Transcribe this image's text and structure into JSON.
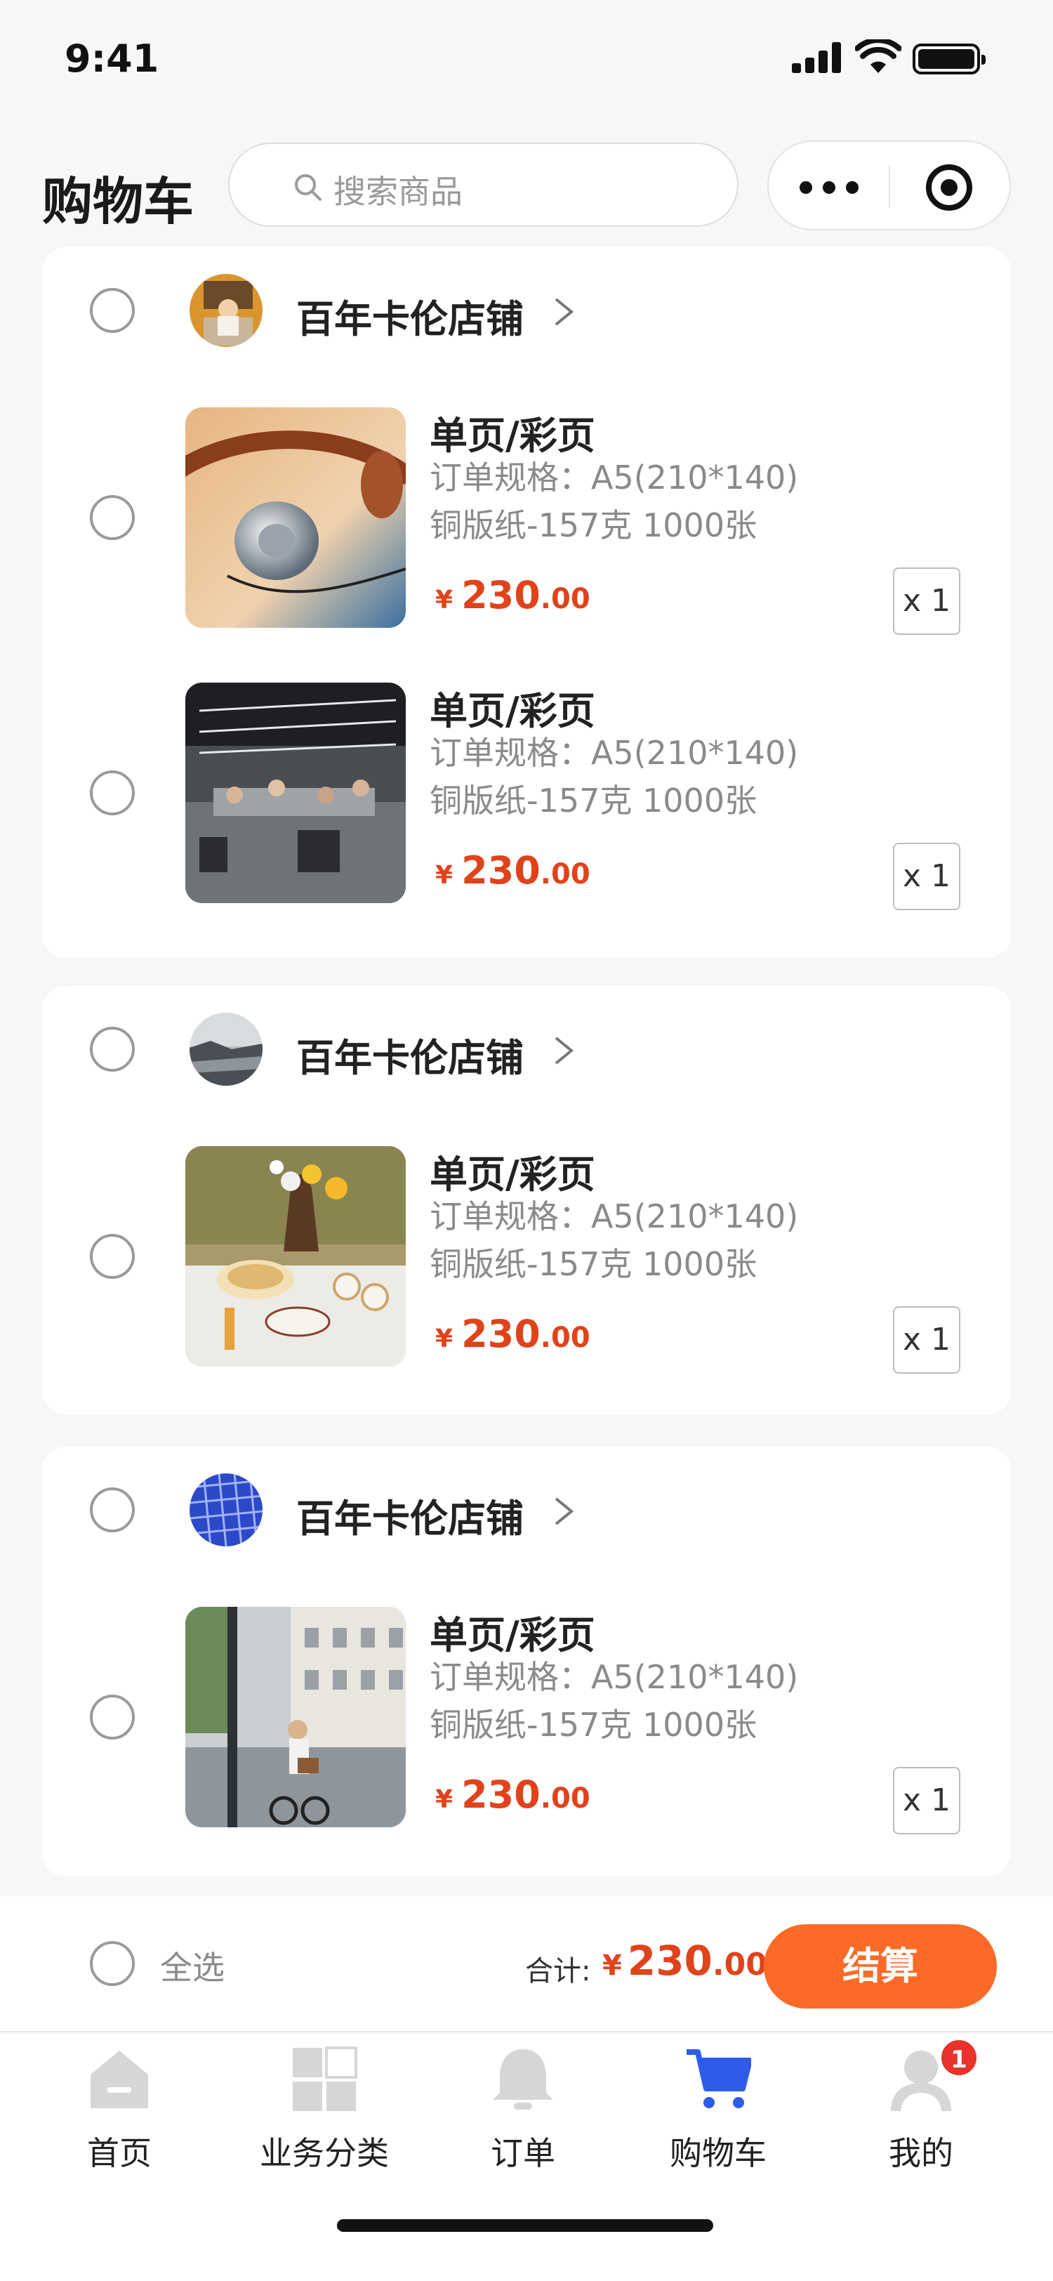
{
  "status_bar": {
    "time": "9:41"
  },
  "header": {
    "title": "购物车",
    "search_placeholder": "搜索商品"
  },
  "shops": [
    {
      "name": "百年卡伦店铺",
      "items": [
        {
          "title": "单页/彩页",
          "spec": "订单规格：A5(210*140)",
          "paper": "铜版纸-157克  1000张",
          "currency": "¥",
          "price_int": "230",
          "price_dec": ".00",
          "qty": "x 1"
        },
        {
          "title": "单页/彩页",
          "spec": "订单规格：A5(210*140)",
          "paper": "铜版纸-157克  1000张",
          "currency": "¥",
          "price_int": "230",
          "price_dec": ".00",
          "qty": "x 1"
        }
      ]
    },
    {
      "name": "百年卡伦店铺",
      "items": [
        {
          "title": "单页/彩页",
          "spec": "订单规格：A5(210*140)",
          "paper": "铜版纸-157克  1000张",
          "currency": "¥",
          "price_int": "230",
          "price_dec": ".00",
          "qty": "x 1"
        }
      ]
    },
    {
      "name": "百年卡伦店铺",
      "items": [
        {
          "title": "单页/彩页",
          "spec": "订单规格：A5(210*140)",
          "paper": "铜版纸-157克  1000张",
          "currency": "¥",
          "price_int": "230",
          "price_dec": ".00",
          "qty": "x 1"
        }
      ]
    }
  ],
  "checkout": {
    "select_all": "全选",
    "total_label": "合计:",
    "currency": "¥",
    "total_int": "230",
    "total_dec": ".00",
    "button": "结算"
  },
  "tabs": [
    {
      "label": "首页",
      "icon": "home-icon"
    },
    {
      "label": "业务分类",
      "icon": "grid-icon"
    },
    {
      "label": "订单",
      "icon": "bell-icon"
    },
    {
      "label": "购物车",
      "icon": "cart-icon",
      "active": true
    },
    {
      "label": "我的",
      "icon": "user-icon",
      "badge": "1"
    }
  ],
  "colors": {
    "accent": "#fb6a26",
    "price": "#e0431b",
    "tab_active": "#2f5bea",
    "tab_inactive": "#d6d6d6",
    "badge": "#e8322a"
  }
}
